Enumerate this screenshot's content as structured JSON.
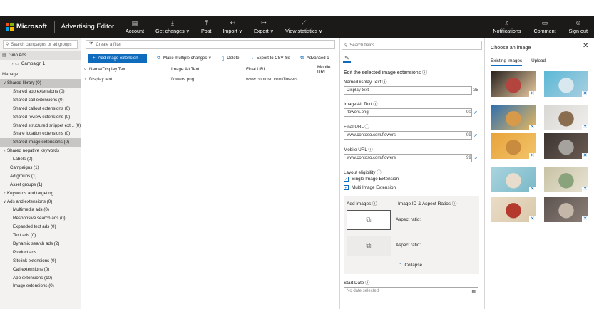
{
  "brand": {
    "company": "Microsoft",
    "app_title": "Advertising Editor"
  },
  "top_menu": [
    {
      "label": "Account",
      "icon": "account-icon"
    },
    {
      "label": "Get changes ∨",
      "icon": "download-icon"
    },
    {
      "label": "Post",
      "icon": "upload-icon"
    },
    {
      "label": "Import ∨",
      "icon": "import-icon"
    },
    {
      "label": "Export ∨",
      "icon": "export-icon"
    },
    {
      "label": "View statistics ∨",
      "icon": "chart-icon"
    }
  ],
  "top_right": [
    {
      "label": "Notifications",
      "icon": "bell-icon"
    },
    {
      "label": "Comment",
      "icon": "comment-icon"
    },
    {
      "label": "Sign out",
      "icon": "person-icon"
    }
  ],
  "sidebar": {
    "search_placeholder": "Search campaigns or ad groups",
    "tree": [
      {
        "label": "Gino Ads",
        "indent": 0,
        "chev": "",
        "type": "hdr",
        "icon": "▤"
      },
      {
        "label": "Campaign 1",
        "indent": 1,
        "chev": "›",
        "type": "",
        "icon": "▭"
      },
      {
        "label": "Manage",
        "indent": 0,
        "chev": "",
        "type": "gap"
      },
      {
        "label": "Shared library (0)",
        "indent": 0,
        "chev": "∨",
        "type": "sel"
      },
      {
        "label": "Shared app extensions (0)",
        "indent": 2,
        "chev": "",
        "type": ""
      },
      {
        "label": "Shared call extensions (0)",
        "indent": 2,
        "chev": "",
        "type": ""
      },
      {
        "label": "Shared callout extensions (0)",
        "indent": 2,
        "chev": "",
        "type": ""
      },
      {
        "label": "Shared review extensions (0)",
        "indent": 2,
        "chev": "",
        "type": ""
      },
      {
        "label": "Shared structured snippet ext... (0)",
        "indent": 2,
        "chev": "",
        "type": ""
      },
      {
        "label": "Share location extensions (0)",
        "indent": 2,
        "chev": "",
        "type": ""
      },
      {
        "label": "Shared image extensions (0)",
        "indent": 2,
        "chev": "",
        "type": "sel"
      },
      {
        "label": "Shared negative keywords",
        "indent": 0,
        "chev": "›",
        "type": ""
      },
      {
        "label": "Labels (0)",
        "indent": 2,
        "chev": "",
        "type": ""
      },
      {
        "label": "Campaigns (1)",
        "indent": 1,
        "chev": "",
        "type": ""
      },
      {
        "label": "Ad groups (1)",
        "indent": 1,
        "chev": "",
        "type": ""
      },
      {
        "label": "Asset groups (1)",
        "indent": 1,
        "chev": "",
        "type": ""
      },
      {
        "label": "Keywords and targeting",
        "indent": 0,
        "chev": "›",
        "type": ""
      },
      {
        "label": "Ads and extensions (0)",
        "indent": 0,
        "chev": "∨",
        "type": ""
      },
      {
        "label": "Multimedia ads (0)",
        "indent": 2,
        "chev": "",
        "type": ""
      },
      {
        "label": "Responsive search ads (0)",
        "indent": 2,
        "chev": "",
        "type": ""
      },
      {
        "label": "Expanded text ads (0)",
        "indent": 2,
        "chev": "",
        "type": ""
      },
      {
        "label": "Text ads (0)",
        "indent": 2,
        "chev": "",
        "type": ""
      },
      {
        "label": "Dynamic search ads (2)",
        "indent": 2,
        "chev": "",
        "type": ""
      },
      {
        "label": "Product ads",
        "indent": 2,
        "chev": "",
        "type": ""
      },
      {
        "label": "Sitelink extensions (0)",
        "indent": 2,
        "chev": "",
        "type": ""
      },
      {
        "label": "Call extensions (0)",
        "indent": 2,
        "chev": "",
        "type": ""
      },
      {
        "label": "App extensions (10)",
        "indent": 2,
        "chev": "",
        "type": ""
      },
      {
        "label": "Image extensions (0)",
        "indent": 2,
        "chev": "",
        "type": ""
      }
    ]
  },
  "center": {
    "filter_placeholder": "Create a filter",
    "toolbar": {
      "add_label": "Add image extension",
      "make_multiple": "Make multiple changes ∨",
      "delete": "Delete",
      "export_csv": "Export to CSV file",
      "advanced": "Advanced c"
    },
    "columns": [
      "Name/Display Text",
      "Image Alt Text",
      "Final URL",
      "Mobile URL"
    ],
    "rows": [
      {
        "name": "Display text",
        "alt": "flowers.png",
        "url": "www.contoso.com/flowers",
        "mobile": ""
      }
    ]
  },
  "edit": {
    "search_placeholder": "Search fields",
    "title": "Edit the selected image extensions",
    "fields": {
      "name_label": "Name/Display Text",
      "name_value": "Display text",
      "name_count": "35",
      "alt_label": "Image Alt Text",
      "alt_value": "flowers.png",
      "alt_count": "90",
      "final_label": "Final URL",
      "final_value": "www.contoso.com/flowers",
      "final_count": "99",
      "mobile_label": "Mobile URL",
      "mobile_value": "www.contoso.com/flowers",
      "mobile_count": "99"
    },
    "layout_label": "Layout eligibility",
    "checks": [
      "Single Image Extension",
      "Multi Image Extension"
    ],
    "add_images_label": "Add images",
    "image_id_label": "Image ID & Aspect Ratios",
    "aspect_ratio_label": "Aspect ratio:",
    "collapse_label": "Collapse",
    "start_date_label": "Start Date",
    "start_date_placeholder": "No date selected"
  },
  "chooser": {
    "title": "Choose an image",
    "tabs": [
      "Existing images",
      "Upload"
    ],
    "images": [
      {
        "name": "flowers-bouquet-image",
        "colors": [
          "#2a2320",
          "#b4443e",
          "#e8c9a0"
        ]
      },
      {
        "name": "kitten-on-blue-image",
        "colors": [
          "#5bb8d6",
          "#d9e8ef",
          "#aacfe0"
        ]
      },
      {
        "name": "dog-with-sunglasses-image",
        "colors": [
          "#2f6fae",
          "#d79a4a",
          "#e6b75e"
        ]
      },
      {
        "name": "kitten-in-box-image",
        "colors": [
          "#d9d7d3",
          "#8a6d4f",
          "#f0efed"
        ]
      },
      {
        "name": "puppy-on-orange-image",
        "colors": [
          "#e8a33a",
          "#c98c3e",
          "#f2c46b"
        ]
      },
      {
        "name": "cat-on-desk-image",
        "colors": [
          "#3c3431",
          "#a6a29d",
          "#6b5c53"
        ]
      },
      {
        "name": "cat-reaching-image",
        "colors": [
          "#a9d4de",
          "#e8dccd",
          "#7ab9c8"
        ]
      },
      {
        "name": "coffee-jar-image",
        "colors": [
          "#c7c2a4",
          "#8aa37d",
          "#e8e4d4"
        ]
      },
      {
        "name": "red-phone-image",
        "colors": [
          "#eadcc6",
          "#b43a2e",
          "#d9c8ab"
        ]
      },
      {
        "name": "cat-on-sofa-image",
        "colors": [
          "#5c5350",
          "#c4b6a8",
          "#8c7f77"
        ]
      }
    ]
  },
  "colors": {
    "accent": "#0f6cbd",
    "topbar": "#1b1a19",
    "sidebar_bg": "#f3f2f1"
  }
}
